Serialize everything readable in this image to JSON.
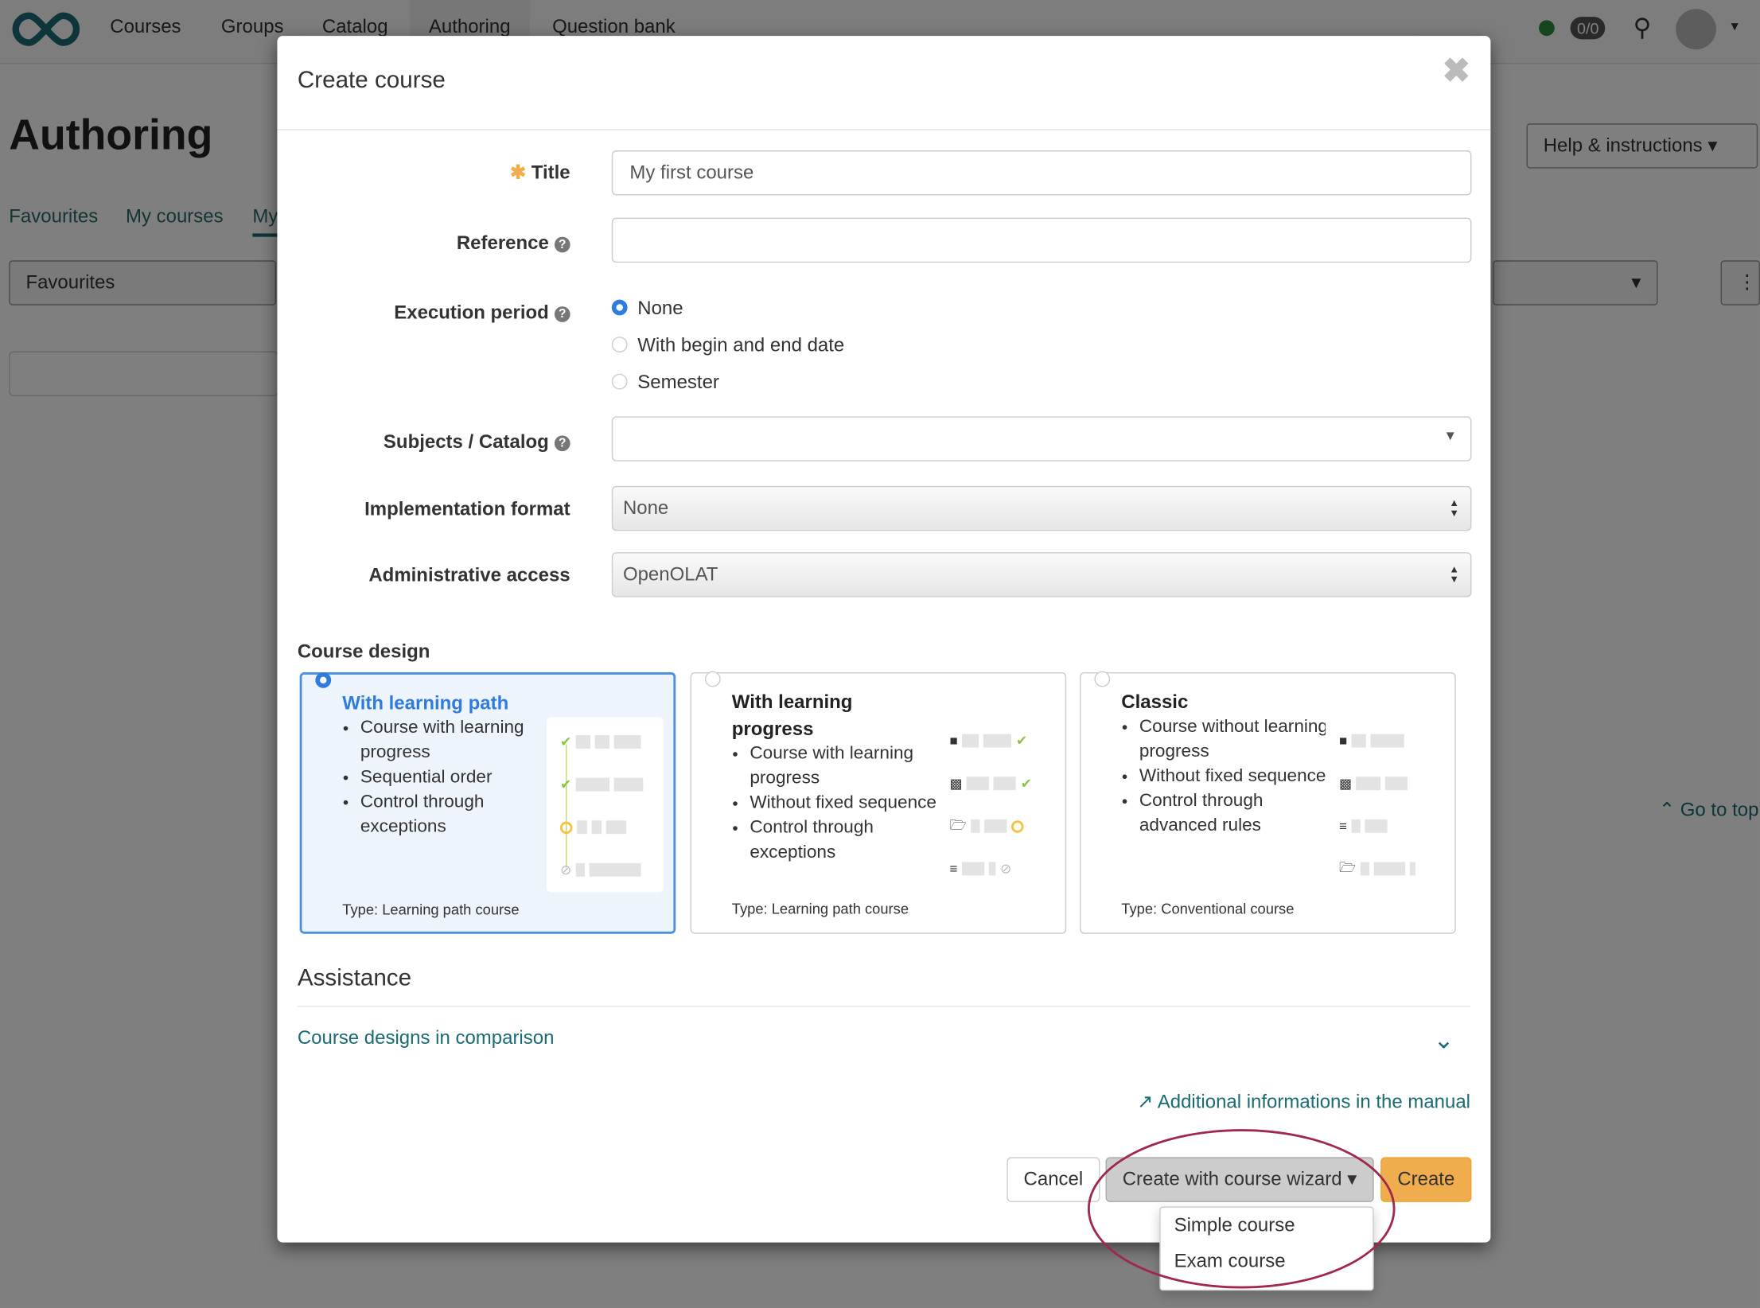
{
  "nav": {
    "items": [
      "Courses",
      "Groups",
      "Catalog",
      "Authoring",
      "Question bank"
    ],
    "active": "Authoring",
    "badge": "0/0"
  },
  "page": {
    "title": "Authoring",
    "tabs": [
      "Favourites",
      "My courses",
      "My"
    ],
    "filter": "Favourites",
    "help": "Help & instructions",
    "go_top": "Go to top"
  },
  "dialog": {
    "title": "Create course",
    "title_label": "Title",
    "title_value": "My first course",
    "reference_label": "Reference",
    "reference_value": "",
    "execution_label": "Execution period",
    "execution_options": [
      "None",
      "With begin and end date",
      "Semester"
    ],
    "execution_selected": "None",
    "subjects_label": "Subjects / Catalog",
    "subjects_value": "",
    "impl_label": "Implementation format",
    "impl_value": "None",
    "admin_label": "Administrative access",
    "admin_value": "OpenOLAT",
    "design_label": "Course design",
    "designs": [
      {
        "title": "With learning path",
        "bullets": [
          "Course with learning progress",
          "Sequential order",
          "Control through exceptions"
        ],
        "type": "Type: Learning path course",
        "selected": true
      },
      {
        "title": "With learning progress",
        "bullets": [
          "Course with learning progress",
          "Without fixed sequence",
          "Control through exceptions"
        ],
        "type": "Type: Learning path course",
        "selected": false
      },
      {
        "title": "Classic",
        "bullets": [
          "Course without learning progress",
          "Without fixed sequence",
          "Control through advanced rules"
        ],
        "type": "Type: Conventional course",
        "selected": false
      }
    ],
    "assistance": "Assistance",
    "comparison": "Course designs in comparison",
    "manual": "Additional informations in the manual",
    "cancel": "Cancel",
    "wizard": "Create with course wizard",
    "create": "Create",
    "wizard_menu": [
      "Simple course",
      "Exam course"
    ]
  },
  "colors": {
    "accent": "#2f7be0",
    "create": "#f0ad4e",
    "highlight": "#a0284a",
    "link": "#1b6b74"
  }
}
